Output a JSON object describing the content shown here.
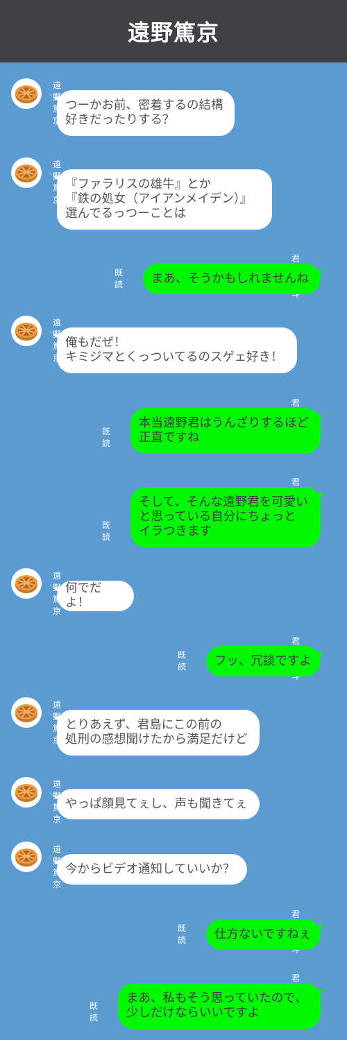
{
  "header": {
    "title": "遠野篤京"
  },
  "read_label": "既読",
  "colors": {
    "background": "#5b9bd1",
    "header": "#404045",
    "own_bubble": "#00f800",
    "other_bubble": "#ffffff"
  },
  "messages": [
    {
      "sender": "遠野篤京",
      "text": "つーかお前、密着するの結構\n好きだったりする？"
    },
    {
      "sender": "遠野篤京",
      "text": "『ファラリスの雄牛』とか\n『鉄の処女（アイアンメイデン）』\n選んでるっつーことは"
    },
    {
      "sender": "君島育斗",
      "text": "まあ、そうかもしれませんね"
    },
    {
      "sender": "遠野篤京",
      "text": "俺もだぜ！\nキミジマとくっついてるのスゲェ好き！"
    },
    {
      "sender": "君島育斗",
      "text": "本当遠野君はうんざりするほど\n正直ですね"
    },
    {
      "sender": "君島育斗",
      "text": "そして、そんな遠野君を可愛い\nと思っている自分にちょっと\nイラつきます"
    },
    {
      "sender": "遠野篤京",
      "text": "何でだよ！"
    },
    {
      "sender": "君島育斗",
      "text": "フッ、冗談ですよ"
    },
    {
      "sender": "遠野篤京",
      "text": "とりあえず、君島にこの前の\n処刑の感想聞けたから満足だけど"
    },
    {
      "sender": "遠野篤京",
      "text": "やっぱ顔見てぇし、声も聞きてぇ"
    },
    {
      "sender": "遠野篤京",
      "text": "今からビデオ通知していいか？"
    },
    {
      "sender": "君島育斗",
      "text": "仕方ないですねぇ"
    },
    {
      "sender": "君島育斗",
      "text": "まあ、私もそう思っていたので、\n少しだけならいいですよ"
    }
  ]
}
